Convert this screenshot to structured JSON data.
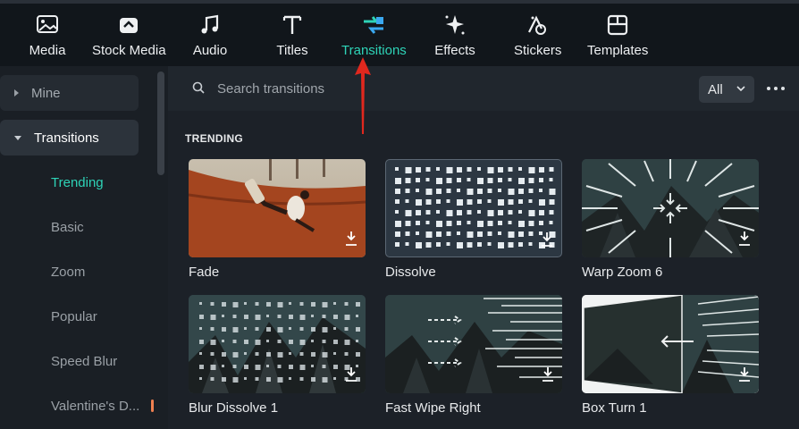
{
  "toolbar": {
    "items": [
      {
        "label": "Media",
        "icon": "media-icon"
      },
      {
        "label": "Stock Media",
        "icon": "stock-media-icon"
      },
      {
        "label": "Audio",
        "icon": "music-note-icon"
      },
      {
        "label": "Titles",
        "icon": "text-t-icon"
      },
      {
        "label": "Transitions",
        "icon": "transitions-icon",
        "active": true
      },
      {
        "label": "Effects",
        "icon": "effects-sparkle-icon"
      },
      {
        "label": "Stickers",
        "icon": "stickers-icon"
      },
      {
        "label": "Templates",
        "icon": "templates-icon"
      }
    ]
  },
  "sidebar": {
    "mine": "Mine",
    "transitions": "Transitions",
    "subitems": [
      "Trending",
      "Basic",
      "Zoom",
      "Popular",
      "Speed Blur",
      "Valentine's D..."
    ]
  },
  "search": {
    "placeholder": "Search transitions",
    "filter_value": "All"
  },
  "section": {
    "title": "TRENDING"
  },
  "cards": [
    {
      "name": "Fade"
    },
    {
      "name": "Dissolve"
    },
    {
      "name": "Warp Zoom 6"
    },
    {
      "name": "Blur Dissolve 1"
    },
    {
      "name": "Fast Wipe Right"
    },
    {
      "name": "Box Turn 1"
    }
  ],
  "colors": {
    "accent": "#2ed3b7",
    "annotation_arrow": "#e0281e",
    "thumb_teal": "#2b3a3d"
  }
}
